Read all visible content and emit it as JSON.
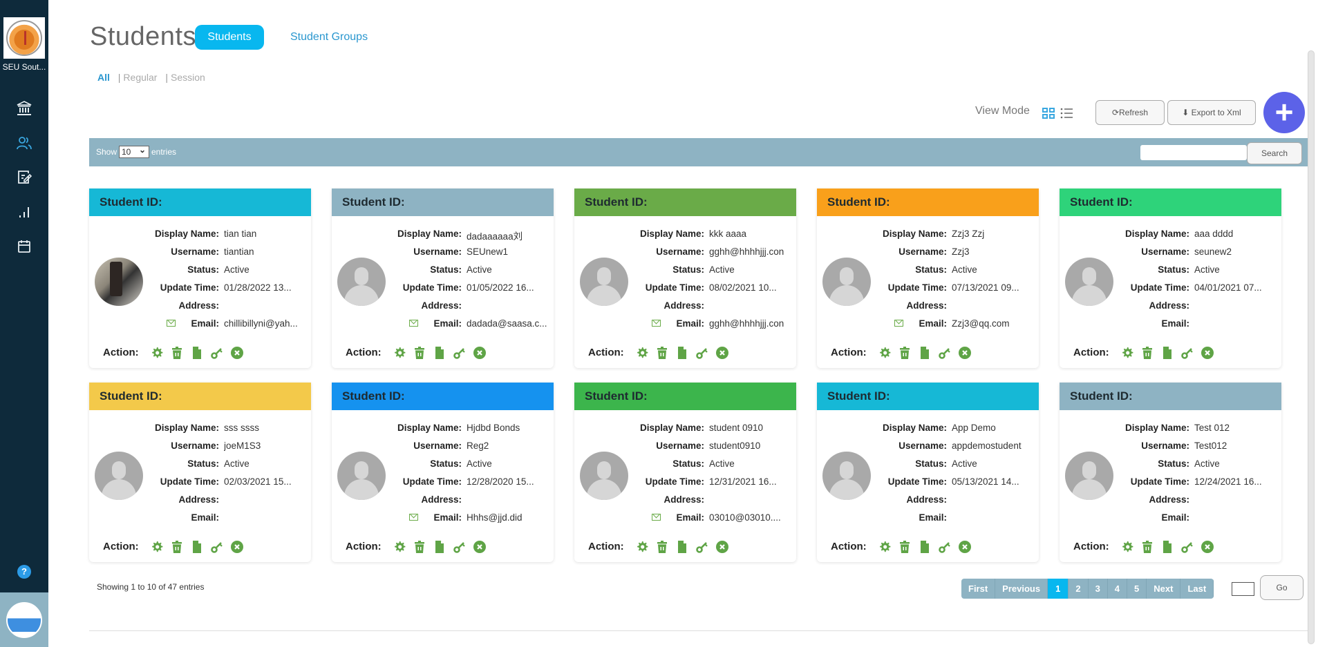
{
  "sidebar": {
    "org_name": "SEU Sout...",
    "nav": [
      {
        "icon": "institution-icon",
        "label": "Institution"
      },
      {
        "icon": "users-icon",
        "label": "Students",
        "active": true
      },
      {
        "icon": "assignment-icon",
        "label": "Assignments"
      },
      {
        "icon": "bar-chart-icon",
        "label": "Reports"
      },
      {
        "icon": "calendar-icon",
        "label": "Calendar"
      }
    ],
    "help_label": "?"
  },
  "header": {
    "title": "Students",
    "tabs": [
      {
        "label": "Students",
        "active": true
      },
      {
        "label": "Student Groups",
        "active": false
      }
    ],
    "filters": [
      {
        "label": "All",
        "active": true
      },
      {
        "label": "Regular",
        "active": false
      },
      {
        "label": "Session",
        "active": false
      }
    ],
    "filter_separator": "|",
    "view_mode_label": "View Mode",
    "refresh_label": "Refresh",
    "export_label": "Export to Xml",
    "add_label": "+"
  },
  "table_controls": {
    "show_label": "Show",
    "page_size": "10",
    "entries_label": "entries",
    "search_value": "",
    "search_button": "Search"
  },
  "card_labels": {
    "header": "Student ID:",
    "display_name": "Display Name:",
    "username": "Username:",
    "status": "Status:",
    "update_time": "Update Time:",
    "address": "Address:",
    "email": "Email:",
    "action": "Action:"
  },
  "students": [
    {
      "color": "#16b8d6",
      "display_name": "tian tian",
      "username": "tiantian",
      "status": "Active",
      "update_time": "01/28/2022 13...",
      "address": "",
      "email": "chillibillyni@yah...",
      "has_email_icon": true,
      "photo": true
    },
    {
      "color": "#8eb3c3",
      "display_name": "dadaaaaaa刘",
      "username": "SEUnew1",
      "status": "Active",
      "update_time": "01/05/2022 16...",
      "address": "",
      "email": "dadada@saasa.c...",
      "has_email_icon": true,
      "photo": false
    },
    {
      "color": "#6aab48",
      "display_name": "kkk aaaa",
      "username": "gghh@hhhhjjj.con",
      "status": "Active",
      "update_time": "08/02/2021 10...",
      "address": "",
      "email": "gghh@hhhhjjj.con",
      "has_email_icon": true,
      "photo": false
    },
    {
      "color": "#f9a01b",
      "display_name": "Zzj3 Zzj",
      "username": "Zzj3",
      "status": "Active",
      "update_time": "07/13/2021 09...",
      "address": "",
      "email": "Zzj3@qq.com",
      "has_email_icon": true,
      "photo": false
    },
    {
      "color": "#2ed37a",
      "display_name": "aaa dddd",
      "username": "seunew2",
      "status": "Active",
      "update_time": "04/01/2021 07...",
      "address": "",
      "email": "",
      "has_email_icon": false,
      "photo": false
    },
    {
      "color": "#f3c94a",
      "display_name": "sss ssss",
      "username": "joeM1S3",
      "status": "Active",
      "update_time": "02/03/2021 15...",
      "address": "",
      "email": "",
      "has_email_icon": false,
      "photo": false
    },
    {
      "color": "#1592ef",
      "display_name": "Hjdbd Bonds",
      "username": "Reg2",
      "status": "Active",
      "update_time": "12/28/2020 15...",
      "address": "",
      "email": "Hhhs@jjd.did",
      "has_email_icon": true,
      "photo": false
    },
    {
      "color": "#3cb54c",
      "display_name": "student 0910",
      "username": "student0910",
      "status": "Active",
      "update_time": "12/31/2021 16...",
      "address": "",
      "email": "03010@03010....",
      "has_email_icon": true,
      "photo": false
    },
    {
      "color": "#16b8d6",
      "display_name": "App Demo",
      "username": "appdemostudent",
      "status": "Active",
      "update_time": "05/13/2021 14...",
      "address": "",
      "email": "",
      "has_email_icon": false,
      "photo": false
    },
    {
      "color": "#8eb3c3",
      "display_name": "Test 012",
      "username": "Test012",
      "status": "Active",
      "update_time": "12/24/2021 16...",
      "address": "",
      "email": "",
      "has_email_icon": false,
      "photo": false
    }
  ],
  "actions": [
    {
      "icon": "settings-icon",
      "label": "Settings"
    },
    {
      "icon": "trash-icon",
      "label": "Delete"
    },
    {
      "icon": "document-icon",
      "label": "Details"
    },
    {
      "icon": "key-icon",
      "label": "Reset Password"
    },
    {
      "icon": "close-circle-icon",
      "label": "Deactivate"
    }
  ],
  "action_color": "#5fa446",
  "footer": {
    "showing": "Showing 1 to 10 of 47 entries",
    "pager": [
      "First",
      "Previous",
      "1",
      "2",
      "3",
      "4",
      "5",
      "Next",
      "Last"
    ],
    "current_page": "1",
    "goto_value": "",
    "go_label": "Go"
  }
}
